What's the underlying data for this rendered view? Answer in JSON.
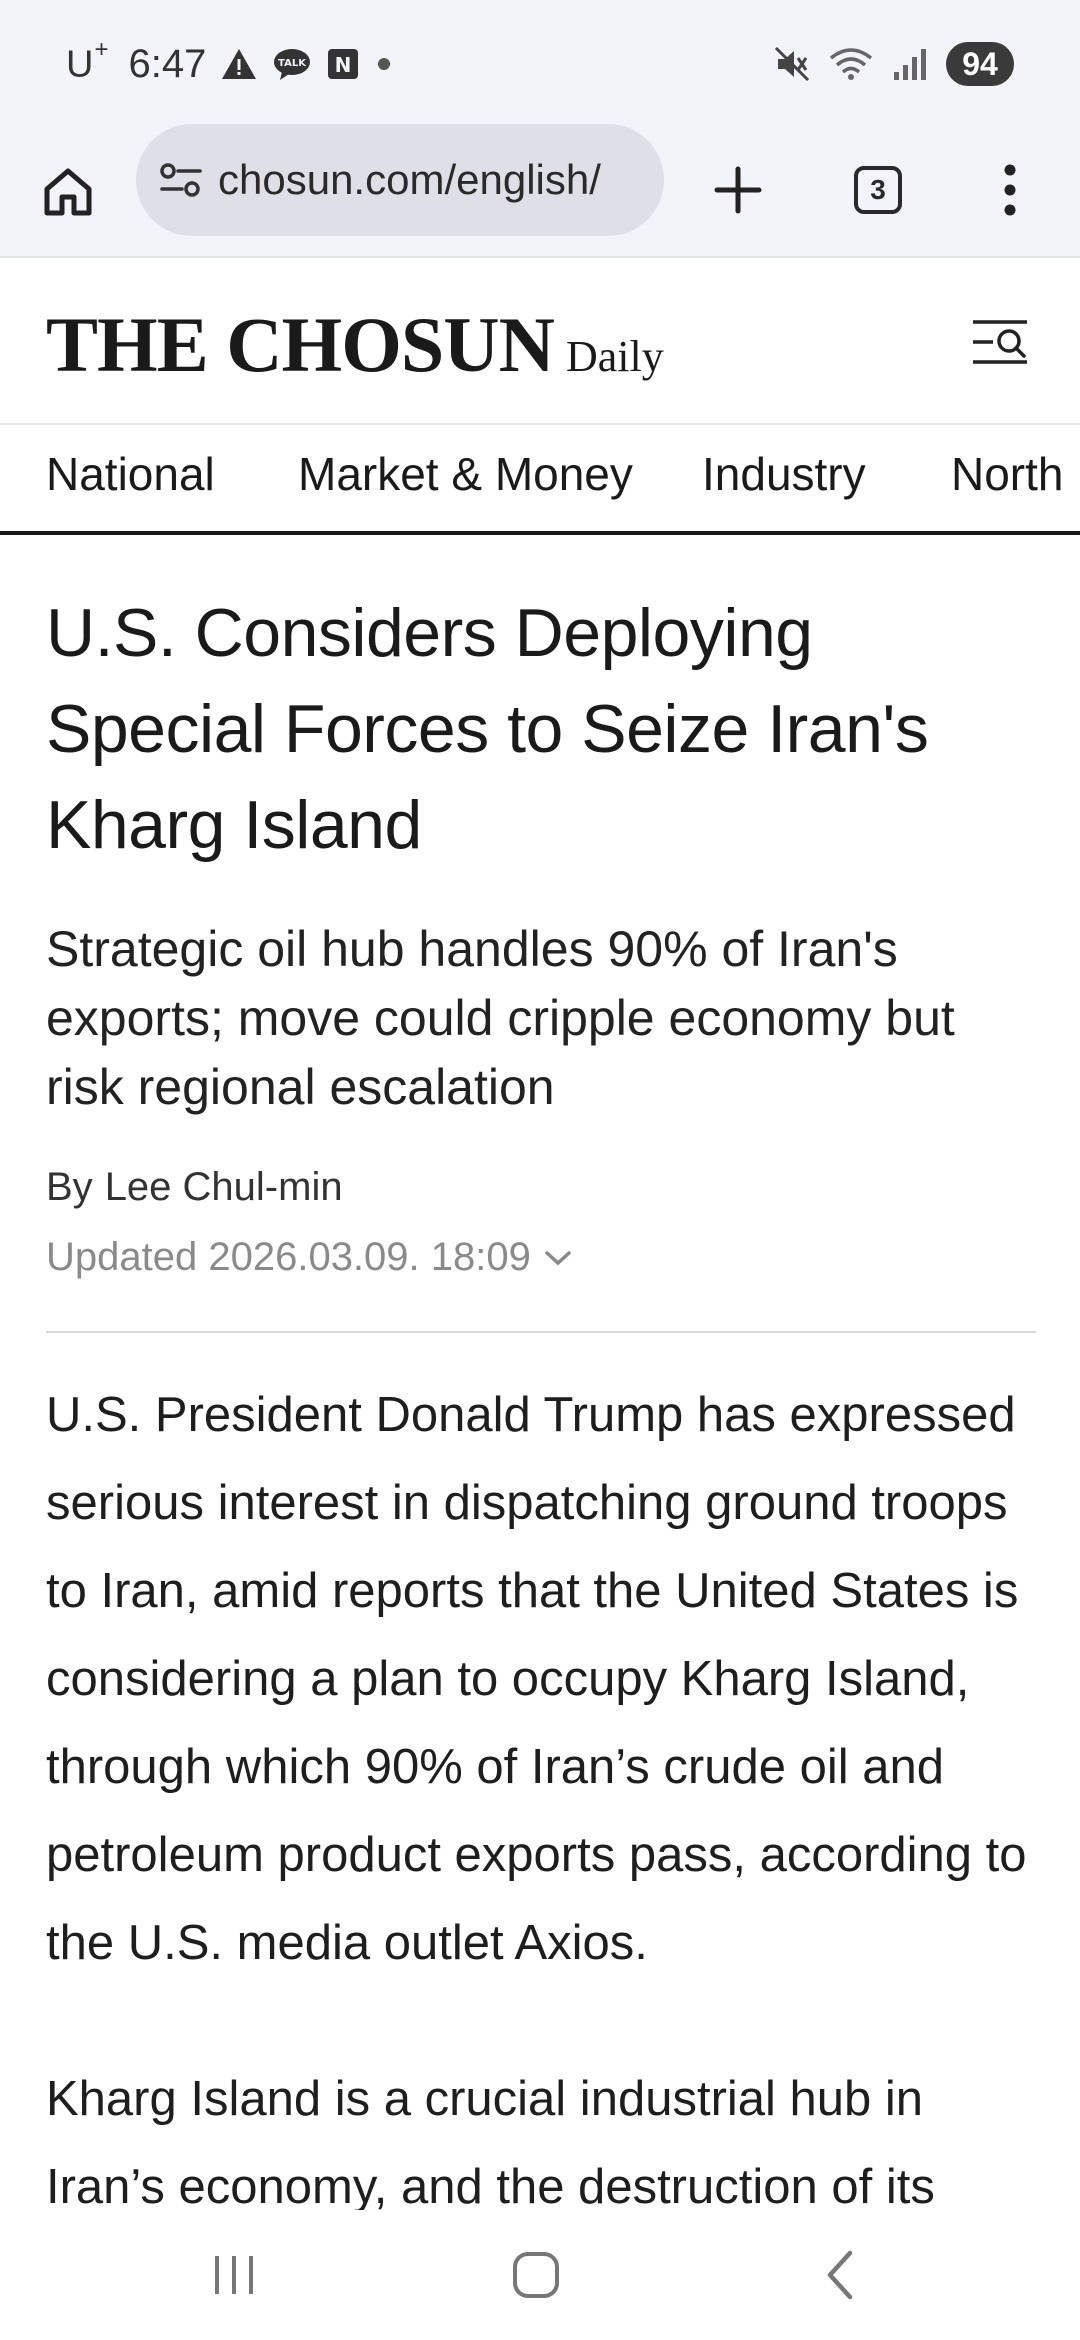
{
  "status_bar": {
    "carrier": "U",
    "carrier_sup": "+",
    "time": "6:47",
    "battery": "94",
    "notification_icons": [
      "warning-icon",
      "talk-icon",
      "n-icon",
      "dot-icon"
    ],
    "system_icons": [
      "mute-icon",
      "wifi-icon",
      "signal-icon"
    ]
  },
  "browser": {
    "url": "chosun.com/english/",
    "tab_count": "3"
  },
  "site": {
    "logo_main": "THE CHOSUN",
    "logo_sub": "Daily"
  },
  "nav": {
    "categories": [
      "National",
      "Market & Money",
      "Industry",
      "North"
    ]
  },
  "article": {
    "headline": "U.S. Considers Deploying Special Forces to Seize Iran's Kharg Island",
    "subhead": "Strategic oil hub handles 90% of Iran's exports; move could cripple economy but risk regional escalation",
    "byline_prefix": "By",
    "author": "Lee Chul-min",
    "updated": "Updated 2026.03.09. 18:09",
    "paragraphs": [
      "U.S. President Donald Trump has expressed serious interest in dispatching ground troops to Iran, amid reports that the United States is considering a plan to occupy Kharg Island, through which 90% of Iran’s crude oil and petroleum product exports pass, according to the U.S. media outlet Axios.",
      "Kharg Island is a crucial industrial hub in Iran’s economy, and the destruction of its"
    ]
  },
  "colors": {
    "chrome_bg": "#f3f3fa",
    "url_pill": "#dfdfe8",
    "text": "#1a1a1a",
    "muted": "#8a8a8a"
  }
}
